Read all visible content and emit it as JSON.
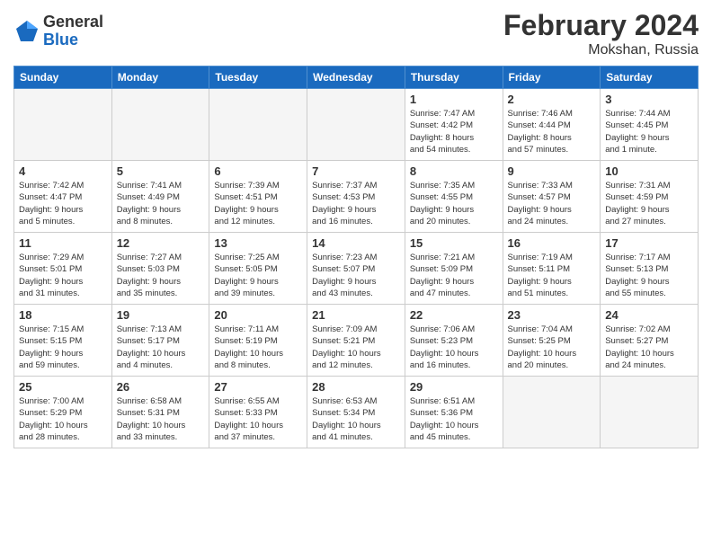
{
  "logo": {
    "general": "General",
    "blue": "Blue"
  },
  "title": "February 2024",
  "location": "Mokshan, Russia",
  "weekdays": [
    "Sunday",
    "Monday",
    "Tuesday",
    "Wednesday",
    "Thursday",
    "Friday",
    "Saturday"
  ],
  "weeks": [
    [
      {
        "day": "",
        "info": ""
      },
      {
        "day": "",
        "info": ""
      },
      {
        "day": "",
        "info": ""
      },
      {
        "day": "",
        "info": ""
      },
      {
        "day": "1",
        "info": "Sunrise: 7:47 AM\nSunset: 4:42 PM\nDaylight: 8 hours\nand 54 minutes."
      },
      {
        "day": "2",
        "info": "Sunrise: 7:46 AM\nSunset: 4:44 PM\nDaylight: 8 hours\nand 57 minutes."
      },
      {
        "day": "3",
        "info": "Sunrise: 7:44 AM\nSunset: 4:45 PM\nDaylight: 9 hours\nand 1 minute."
      }
    ],
    [
      {
        "day": "4",
        "info": "Sunrise: 7:42 AM\nSunset: 4:47 PM\nDaylight: 9 hours\nand 5 minutes."
      },
      {
        "day": "5",
        "info": "Sunrise: 7:41 AM\nSunset: 4:49 PM\nDaylight: 9 hours\nand 8 minutes."
      },
      {
        "day": "6",
        "info": "Sunrise: 7:39 AM\nSunset: 4:51 PM\nDaylight: 9 hours\nand 12 minutes."
      },
      {
        "day": "7",
        "info": "Sunrise: 7:37 AM\nSunset: 4:53 PM\nDaylight: 9 hours\nand 16 minutes."
      },
      {
        "day": "8",
        "info": "Sunrise: 7:35 AM\nSunset: 4:55 PM\nDaylight: 9 hours\nand 20 minutes."
      },
      {
        "day": "9",
        "info": "Sunrise: 7:33 AM\nSunset: 4:57 PM\nDaylight: 9 hours\nand 24 minutes."
      },
      {
        "day": "10",
        "info": "Sunrise: 7:31 AM\nSunset: 4:59 PM\nDaylight: 9 hours\nand 27 minutes."
      }
    ],
    [
      {
        "day": "11",
        "info": "Sunrise: 7:29 AM\nSunset: 5:01 PM\nDaylight: 9 hours\nand 31 minutes."
      },
      {
        "day": "12",
        "info": "Sunrise: 7:27 AM\nSunset: 5:03 PM\nDaylight: 9 hours\nand 35 minutes."
      },
      {
        "day": "13",
        "info": "Sunrise: 7:25 AM\nSunset: 5:05 PM\nDaylight: 9 hours\nand 39 minutes."
      },
      {
        "day": "14",
        "info": "Sunrise: 7:23 AM\nSunset: 5:07 PM\nDaylight: 9 hours\nand 43 minutes."
      },
      {
        "day": "15",
        "info": "Sunrise: 7:21 AM\nSunset: 5:09 PM\nDaylight: 9 hours\nand 47 minutes."
      },
      {
        "day": "16",
        "info": "Sunrise: 7:19 AM\nSunset: 5:11 PM\nDaylight: 9 hours\nand 51 minutes."
      },
      {
        "day": "17",
        "info": "Sunrise: 7:17 AM\nSunset: 5:13 PM\nDaylight: 9 hours\nand 55 minutes."
      }
    ],
    [
      {
        "day": "18",
        "info": "Sunrise: 7:15 AM\nSunset: 5:15 PM\nDaylight: 9 hours\nand 59 minutes."
      },
      {
        "day": "19",
        "info": "Sunrise: 7:13 AM\nSunset: 5:17 PM\nDaylight: 10 hours\nand 4 minutes."
      },
      {
        "day": "20",
        "info": "Sunrise: 7:11 AM\nSunset: 5:19 PM\nDaylight: 10 hours\nand 8 minutes."
      },
      {
        "day": "21",
        "info": "Sunrise: 7:09 AM\nSunset: 5:21 PM\nDaylight: 10 hours\nand 12 minutes."
      },
      {
        "day": "22",
        "info": "Sunrise: 7:06 AM\nSunset: 5:23 PM\nDaylight: 10 hours\nand 16 minutes."
      },
      {
        "day": "23",
        "info": "Sunrise: 7:04 AM\nSunset: 5:25 PM\nDaylight: 10 hours\nand 20 minutes."
      },
      {
        "day": "24",
        "info": "Sunrise: 7:02 AM\nSunset: 5:27 PM\nDaylight: 10 hours\nand 24 minutes."
      }
    ],
    [
      {
        "day": "25",
        "info": "Sunrise: 7:00 AM\nSunset: 5:29 PM\nDaylight: 10 hours\nand 28 minutes."
      },
      {
        "day": "26",
        "info": "Sunrise: 6:58 AM\nSunset: 5:31 PM\nDaylight: 10 hours\nand 33 minutes."
      },
      {
        "day": "27",
        "info": "Sunrise: 6:55 AM\nSunset: 5:33 PM\nDaylight: 10 hours\nand 37 minutes."
      },
      {
        "day": "28",
        "info": "Sunrise: 6:53 AM\nSunset: 5:34 PM\nDaylight: 10 hours\nand 41 minutes."
      },
      {
        "day": "29",
        "info": "Sunrise: 6:51 AM\nSunset: 5:36 PM\nDaylight: 10 hours\nand 45 minutes."
      },
      {
        "day": "",
        "info": ""
      },
      {
        "day": "",
        "info": ""
      }
    ]
  ]
}
